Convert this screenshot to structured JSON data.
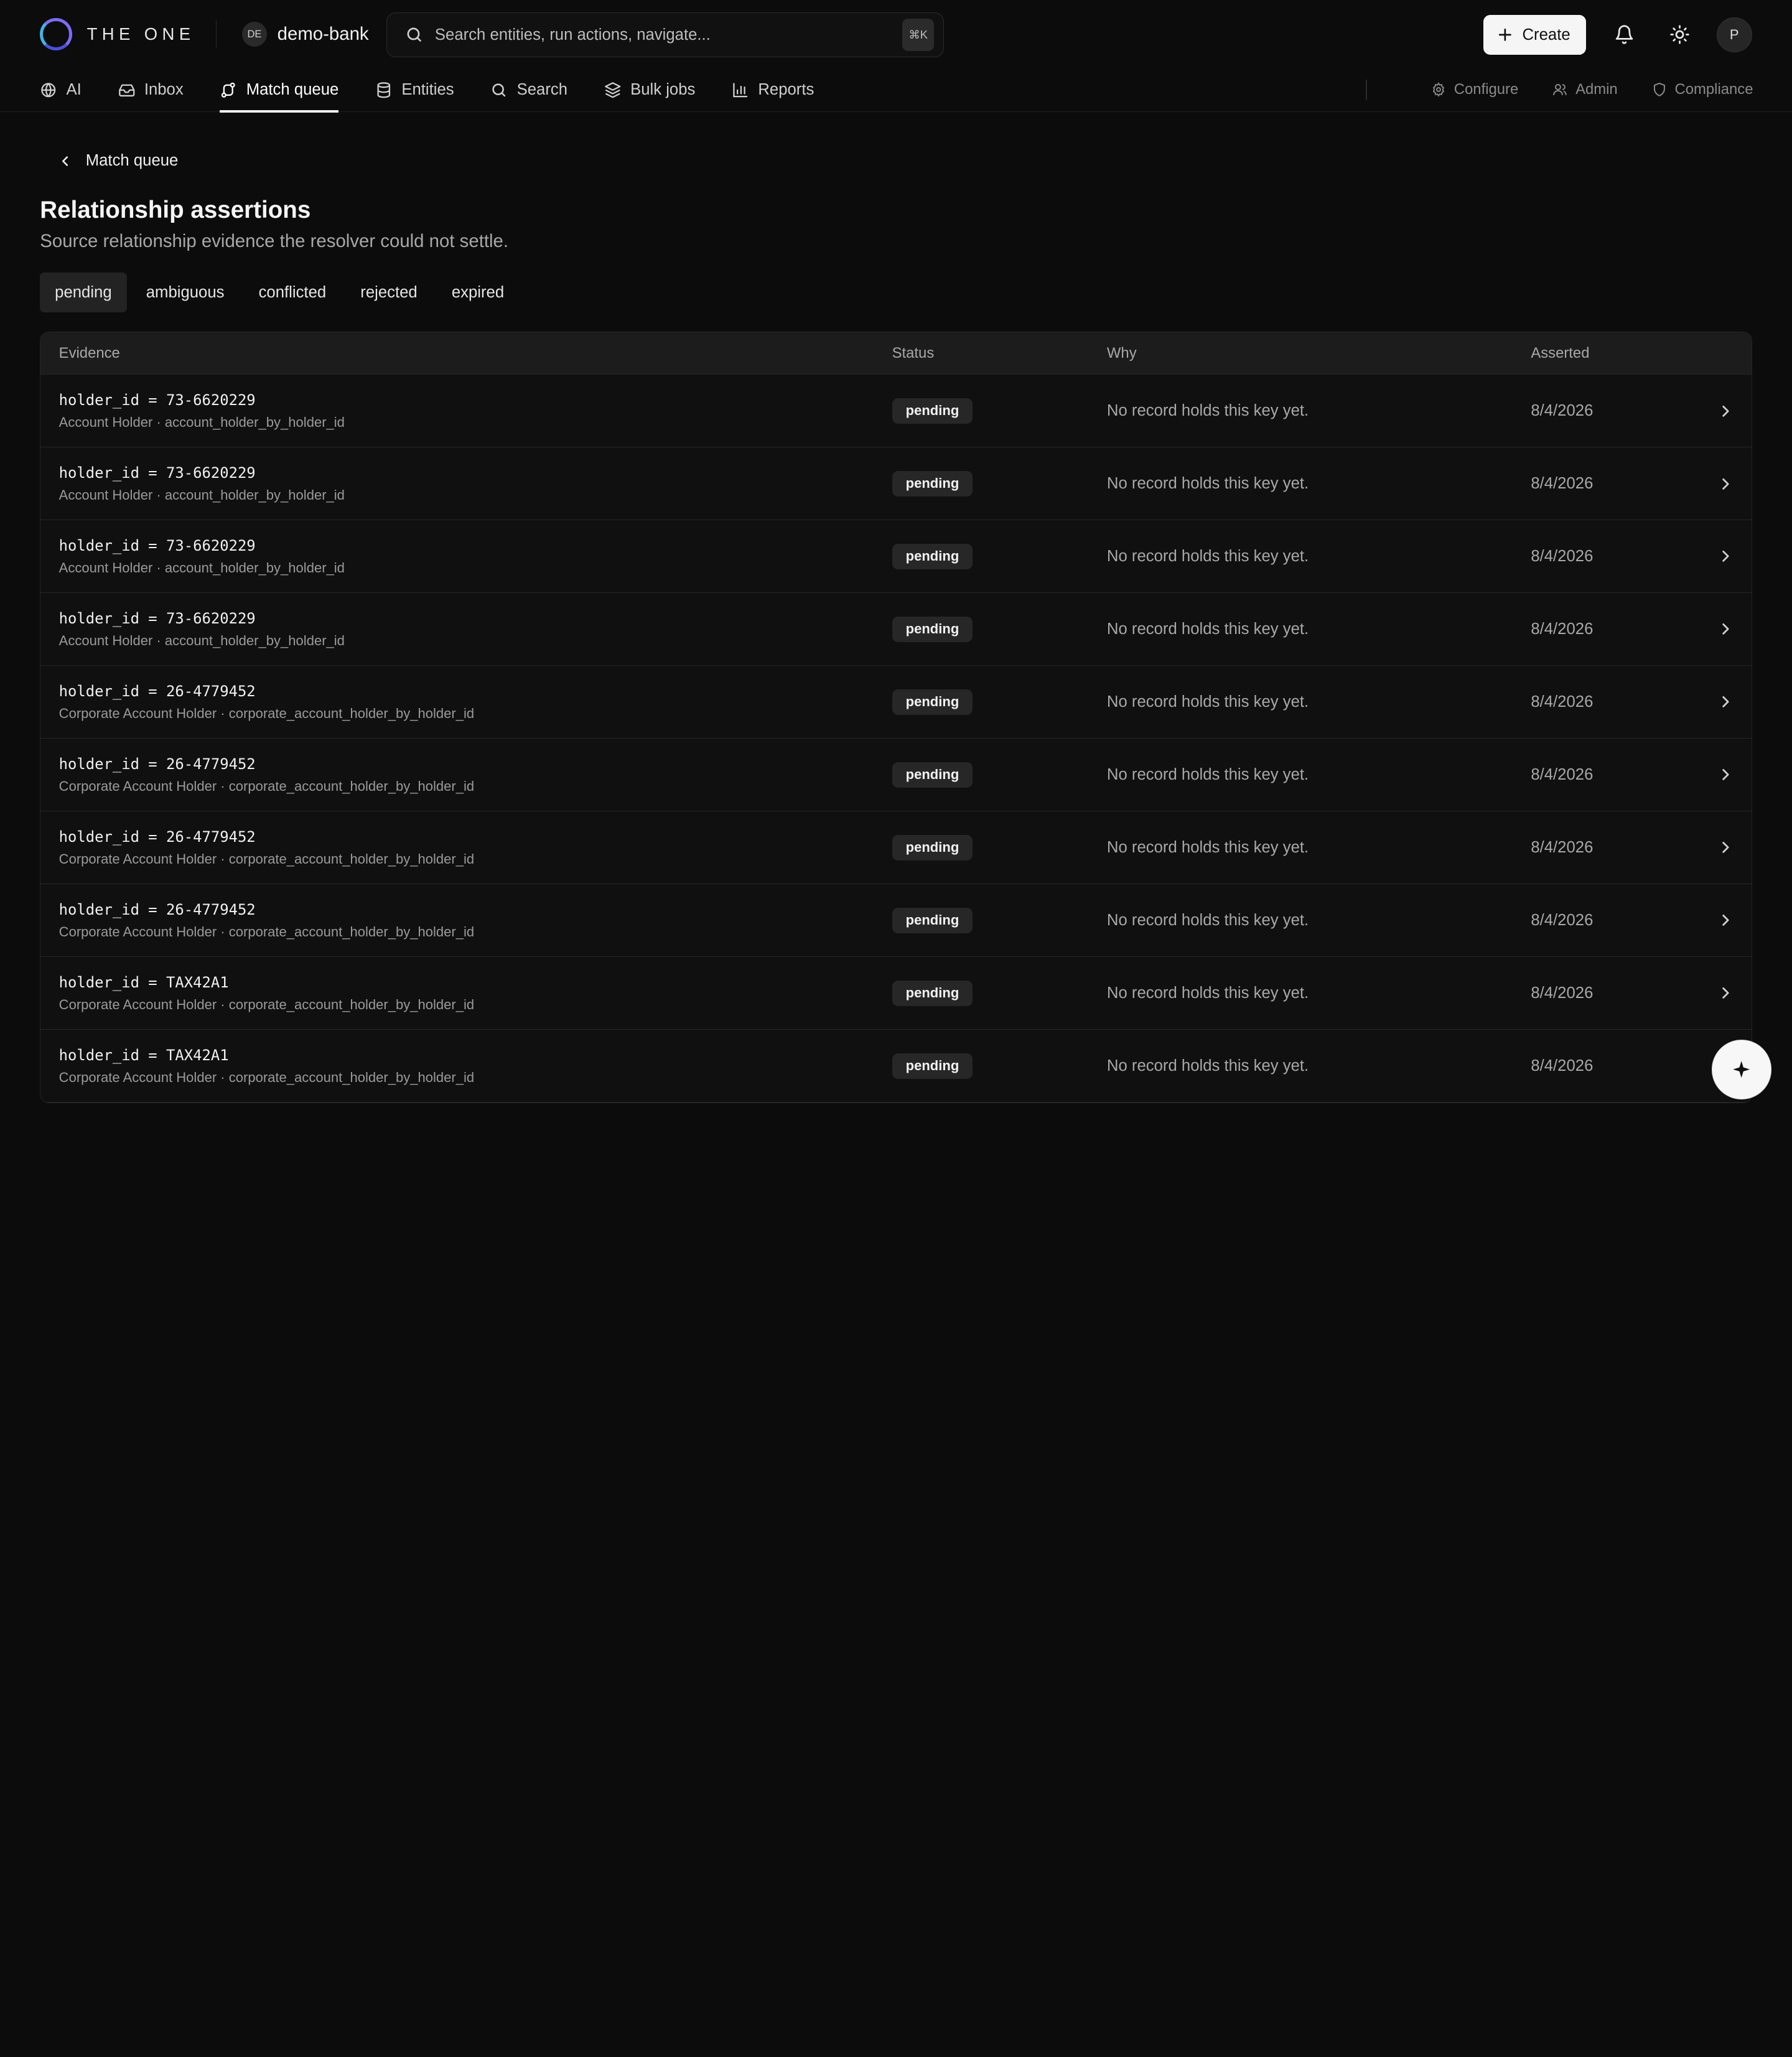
{
  "header": {
    "brand": "THE ONE",
    "workspace_badge": "DE",
    "workspace_name": "demo-bank",
    "search_placeholder": "Search entities, run actions, navigate...",
    "shortcut": "⌘K",
    "create_label": "Create",
    "avatar_initial": "P"
  },
  "nav": {
    "items": [
      {
        "label": "AI",
        "icon": "globe-icon"
      },
      {
        "label": "Inbox",
        "icon": "inbox-icon"
      },
      {
        "label": "Match queue",
        "icon": "route-icon",
        "active": true
      },
      {
        "label": "Entities",
        "icon": "database-icon"
      },
      {
        "label": "Search",
        "icon": "search-icon"
      },
      {
        "label": "Bulk jobs",
        "icon": "layers-icon"
      },
      {
        "label": "Reports",
        "icon": "bar-chart-icon"
      }
    ],
    "secondary": [
      {
        "label": "Configure",
        "icon": "gear-icon"
      },
      {
        "label": "Admin",
        "icon": "users-icon"
      },
      {
        "label": "Compliance",
        "icon": "shield-icon"
      }
    ]
  },
  "main": {
    "back_label": "Match queue",
    "title": "Relationship assertions",
    "subtitle": "Source relationship evidence the resolver could not settle.",
    "tabs": [
      {
        "label": "pending",
        "active": true
      },
      {
        "label": "ambiguous"
      },
      {
        "label": "conflicted"
      },
      {
        "label": "rejected"
      },
      {
        "label": "expired"
      }
    ]
  },
  "table": {
    "columns": {
      "evidence": "Evidence",
      "status": "Status",
      "why": "Why",
      "asserted": "Asserted"
    },
    "rows": [
      {
        "key": "holder_id = 73-6620229",
        "source": "Account Holder · account_holder_by_holder_id",
        "status": "pending",
        "why": "No record holds this key yet.",
        "asserted": "8/4/2026"
      },
      {
        "key": "holder_id = 73-6620229",
        "source": "Account Holder · account_holder_by_holder_id",
        "status": "pending",
        "why": "No record holds this key yet.",
        "asserted": "8/4/2026"
      },
      {
        "key": "holder_id = 73-6620229",
        "source": "Account Holder · account_holder_by_holder_id",
        "status": "pending",
        "why": "No record holds this key yet.",
        "asserted": "8/4/2026"
      },
      {
        "key": "holder_id = 73-6620229",
        "source": "Account Holder · account_holder_by_holder_id",
        "status": "pending",
        "why": "No record holds this key yet.",
        "asserted": "8/4/2026"
      },
      {
        "key": "holder_id = 26-4779452",
        "source": "Corporate Account Holder · corporate_account_holder_by_holder_id",
        "status": "pending",
        "why": "No record holds this key yet.",
        "asserted": "8/4/2026"
      },
      {
        "key": "holder_id = 26-4779452",
        "source": "Corporate Account Holder · corporate_account_holder_by_holder_id",
        "status": "pending",
        "why": "No record holds this key yet.",
        "asserted": "8/4/2026"
      },
      {
        "key": "holder_id = 26-4779452",
        "source": "Corporate Account Holder · corporate_account_holder_by_holder_id",
        "status": "pending",
        "why": "No record holds this key yet.",
        "asserted": "8/4/2026"
      },
      {
        "key": "holder_id = 26-4779452",
        "source": "Corporate Account Holder · corporate_account_holder_by_holder_id",
        "status": "pending",
        "why": "No record holds this key yet.",
        "asserted": "8/4/2026"
      },
      {
        "key": "holder_id = TAX42A1",
        "source": "Corporate Account Holder · corporate_account_holder_by_holder_id",
        "status": "pending",
        "why": "No record holds this key yet.",
        "asserted": "8/4/2026"
      },
      {
        "key": "holder_id = TAX42A1",
        "source": "Corporate Account Holder · corporate_account_holder_by_holder_id",
        "status": "pending",
        "why": "No record holds this key yet.",
        "asserted": "8/4/2026"
      }
    ]
  },
  "fab_icon": "sparkle-icon",
  "colors": {
    "background": "#0c0c0c",
    "accent_ring_start": "#3fb4e8",
    "accent_ring_end": "#7c6cf0"
  }
}
